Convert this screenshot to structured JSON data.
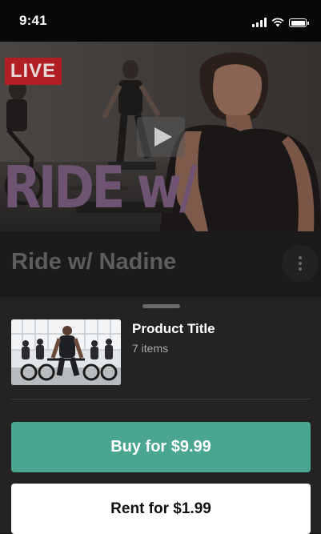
{
  "status_bar": {
    "time": "9:41",
    "icons": [
      "cellular-signal-icon",
      "wifi-icon",
      "battery-icon"
    ]
  },
  "hero": {
    "live_badge": "LIVE",
    "overlay_text": "RIDE w/",
    "play_icon": "play-icon",
    "colors": {
      "live_badge": "#b11f25",
      "overlay_text": "#6e5373"
    }
  },
  "title": {
    "text": "Ride w/ Nadine",
    "more_icon": "more-vertical-icon"
  },
  "sheet": {
    "product_title": "Product Title",
    "product_count": "7 items",
    "buy_label": "Buy for $9.99",
    "rent_label": "Rent for $1.99",
    "colors": {
      "buy_button": "#4aa690",
      "rent_button": "#ffffff"
    }
  }
}
